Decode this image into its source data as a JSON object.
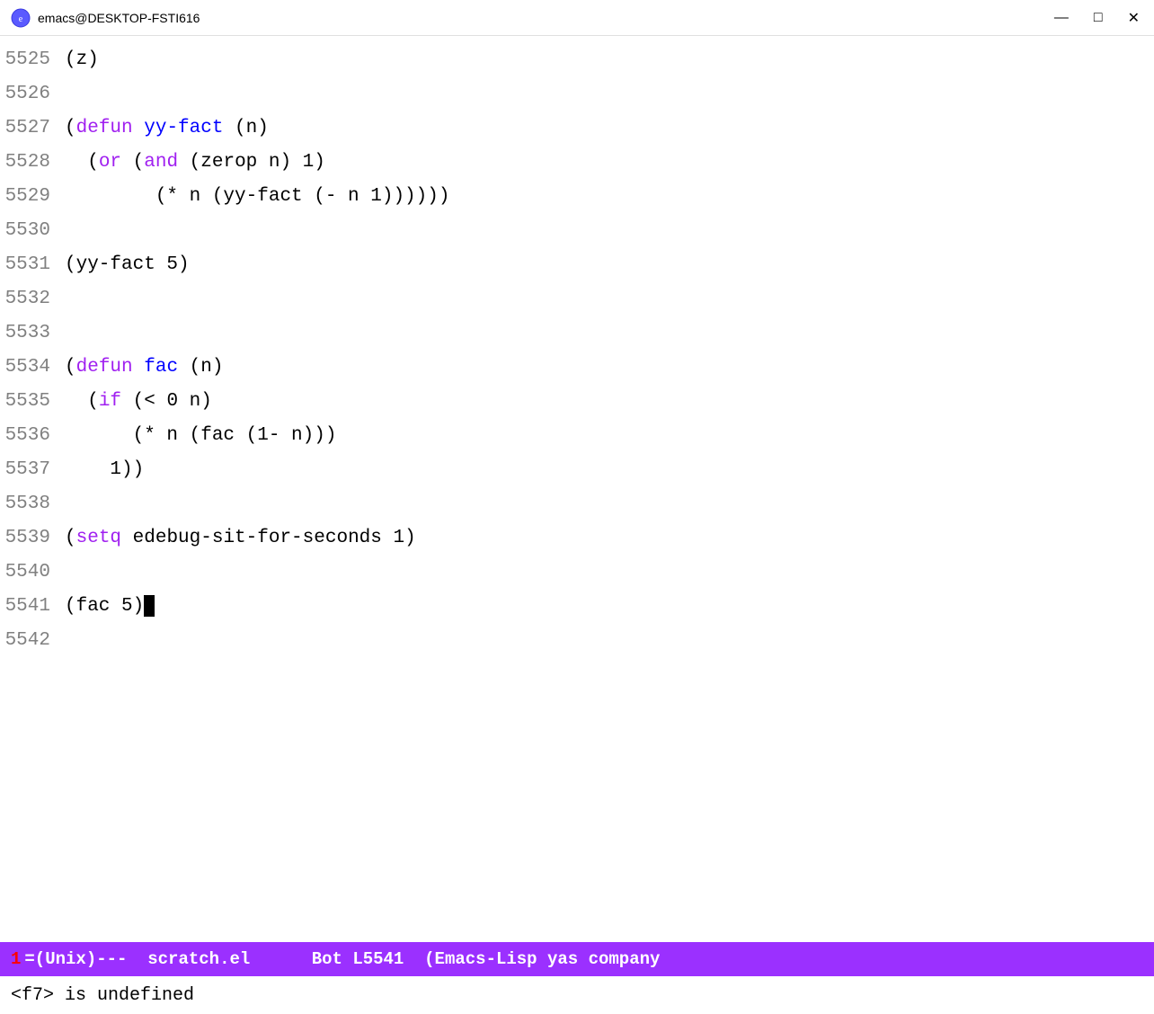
{
  "window": {
    "title": "emacs@DESKTOP-FSTI616",
    "controls": {
      "minimize": "—",
      "maximize": "□",
      "close": "✕"
    }
  },
  "code": {
    "lines": [
      {
        "number": "5525",
        "tokens": [
          {
            "text": "(z)",
            "class": "plain"
          }
        ]
      },
      {
        "number": "5526",
        "tokens": []
      },
      {
        "number": "5527",
        "tokens": [
          {
            "text": "(",
            "class": "plain"
          },
          {
            "text": "defun",
            "class": "kw-defun"
          },
          {
            "text": " ",
            "class": "plain"
          },
          {
            "text": "yy-fact",
            "class": "fn-name"
          },
          {
            "text": " (n)",
            "class": "plain"
          }
        ]
      },
      {
        "number": "5528",
        "tokens": [
          {
            "text": "  (",
            "class": "plain"
          },
          {
            "text": "or",
            "class": "kw-or"
          },
          {
            "text": " (",
            "class": "plain"
          },
          {
            "text": "and",
            "class": "kw-and"
          },
          {
            "text": " (zerop n) 1)",
            "class": "plain"
          }
        ]
      },
      {
        "number": "5529",
        "tokens": [
          {
            "text": "        (* n (yy-fact (- n 1))))))",
            "class": "plain"
          }
        ]
      },
      {
        "number": "5530",
        "tokens": []
      },
      {
        "number": "5531",
        "tokens": [
          {
            "text": "(yy-fact 5)",
            "class": "plain"
          }
        ]
      },
      {
        "number": "5532",
        "tokens": []
      },
      {
        "number": "5533",
        "tokens": []
      },
      {
        "number": "5534",
        "tokens": [
          {
            "text": "(",
            "class": "plain"
          },
          {
            "text": "defun",
            "class": "kw-defun"
          },
          {
            "text": " ",
            "class": "plain"
          },
          {
            "text": "fac",
            "class": "fn-name"
          },
          {
            "text": " (n)",
            "class": "plain"
          }
        ]
      },
      {
        "number": "5535",
        "tokens": [
          {
            "text": "  (",
            "class": "plain"
          },
          {
            "text": "if",
            "class": "kw-if"
          },
          {
            "text": " (< 0 n)",
            "class": "plain"
          }
        ]
      },
      {
        "number": "5536",
        "tokens": [
          {
            "text": "      (* n (fac (1- n)))",
            "class": "plain"
          }
        ]
      },
      {
        "number": "5537",
        "tokens": [
          {
            "text": "    1))",
            "class": "plain"
          }
        ]
      },
      {
        "number": "5538",
        "tokens": []
      },
      {
        "number": "5539",
        "tokens": [
          {
            "text": "(",
            "class": "plain"
          },
          {
            "text": "setq",
            "class": "kw-setq"
          },
          {
            "text": " edebug-sit-for-seconds 1)",
            "class": "plain"
          }
        ]
      },
      {
        "number": "5540",
        "tokens": []
      },
      {
        "number": "5541",
        "tokens": [
          {
            "text": "(fac 5)",
            "class": "plain"
          },
          {
            "text": "CURSOR",
            "class": "cursor-marker"
          }
        ]
      },
      {
        "number": "5542",
        "tokens": []
      }
    ]
  },
  "status_bar": {
    "line_indicator": "1",
    "mode_info": "=(Unix)---",
    "buffer_name": "scratch.el",
    "position": "Bot",
    "line_col": "L5541",
    "modes": "(Emacs-Lisp yas company"
  },
  "echo_area": {
    "message": "<f7> is undefined"
  }
}
